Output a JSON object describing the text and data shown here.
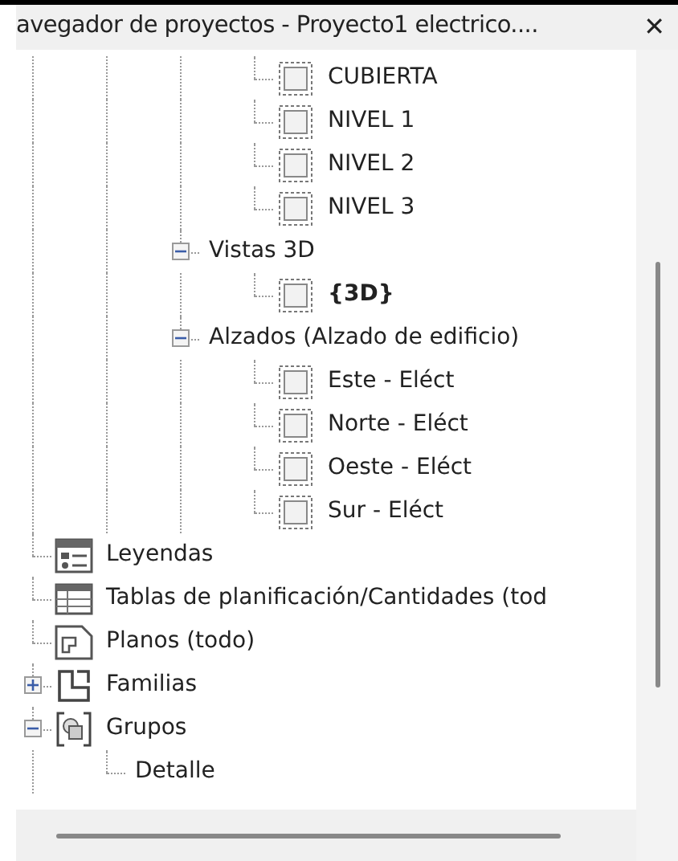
{
  "window": {
    "title": "avegador de proyectos - Proyecto1 electrico....",
    "close": "✕"
  },
  "tree": [
    {
      "children": [
        {
          "children": [
            {
              "children": [
                {
                  "label": "CUBIERTA",
                  "kind": "view",
                  "active": false
                },
                {
                  "label": "NIVEL 1",
                  "kind": "view",
                  "active": false
                },
                {
                  "label": "NIVEL 2",
                  "kind": "view",
                  "active": false
                },
                {
                  "label": "NIVEL 3",
                  "kind": "view",
                  "active": false
                }
              ]
            },
            {
              "label": "Vistas 3D",
              "expanded": true,
              "children": [
                {
                  "label": "{3D}",
                  "kind": "view",
                  "active": true
                }
              ]
            },
            {
              "label": "Alzados (Alzado de edificio)",
              "expanded": true,
              "children": [
                {
                  "label": "Este - Eléct",
                  "kind": "view",
                  "active": false
                },
                {
                  "label": "Norte - Eléct",
                  "kind": "view",
                  "active": false
                },
                {
                  "label": "Oeste - Eléct",
                  "kind": "view",
                  "active": false
                },
                {
                  "label": "Sur - Eléct",
                  "kind": "view",
                  "active": false
                }
              ]
            }
          ]
        }
      ]
    },
    {
      "label": "Leyendas",
      "kind": "legend"
    },
    {
      "label": "Tablas de planificación/Cantidades (tod",
      "kind": "schedule"
    },
    {
      "label": "Planos (todo)",
      "kind": "sheet"
    },
    {
      "label": "Familias",
      "kind": "family",
      "expanded": false
    },
    {
      "label": "Grupos",
      "kind": "group",
      "expanded": true,
      "children": [
        {
          "label": "Detalle"
        }
      ]
    }
  ]
}
